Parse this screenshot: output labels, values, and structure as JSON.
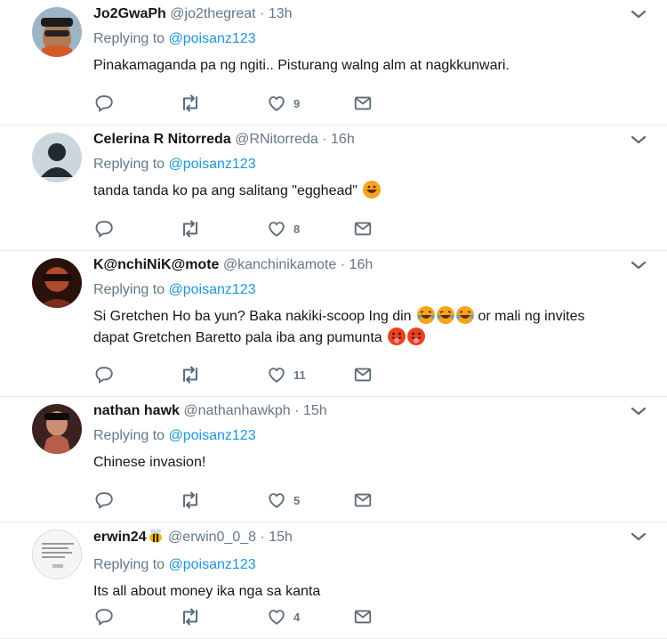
{
  "tweets": [
    {
      "name": "Jo2GwaPh",
      "handle": "@jo2thegreat",
      "time": "13h",
      "reply_prefix": "Replying to",
      "reply_to": "@poisanz123",
      "text": "Pinakamaganda pa ng ngiti.. Pisturang walng alm at nagkkunwari.",
      "likes": "9",
      "avatar_color": "#6d5240"
    },
    {
      "name": "Celerina R Nitorreda",
      "handle": "@RNitorreda",
      "time": "16h",
      "reply_prefix": "Replying to",
      "reply_to": "@poisanz123",
      "text": "tanda tanda ko pa ang salitang \"egghead\"",
      "likes": "8",
      "avatar_color": "#c8d1d9"
    },
    {
      "name": "K@nchiNiK@mote",
      "handle": "@kanchinikamote",
      "time": "16h",
      "reply_prefix": "Replying to",
      "reply_to": "@poisanz123",
      "text_line1": "Si Gretchen Ho ba yun? Baka nakiki-scoop Ing din",
      "text_line1b": "or mali ng invites",
      "text_line2": "dapat Gretchen Baretto pala iba ang pumunta",
      "likes": "11",
      "avatar_color": "#3a1c14"
    },
    {
      "name": "nathan hawk",
      "handle": "@nathanhawkph",
      "time": "15h",
      "reply_prefix": "Replying to",
      "reply_to": "@poisanz123",
      "text": "Chinese invasion!",
      "likes": "5",
      "avatar_color": "#2b1d1b"
    },
    {
      "name": "erwin24",
      "handle": "@erwin0_0_8",
      "time": "15h",
      "reply_prefix": "Replying to",
      "reply_to": "@poisanz123",
      "text": "Its all about money ika nga sa kanta",
      "likes": "4",
      "avatar_color": "#f4f4f4"
    }
  ],
  "separator": "·",
  "colors": {
    "link": "#1b95e0",
    "muted": "#657786",
    "border": "#e6ecf0"
  }
}
